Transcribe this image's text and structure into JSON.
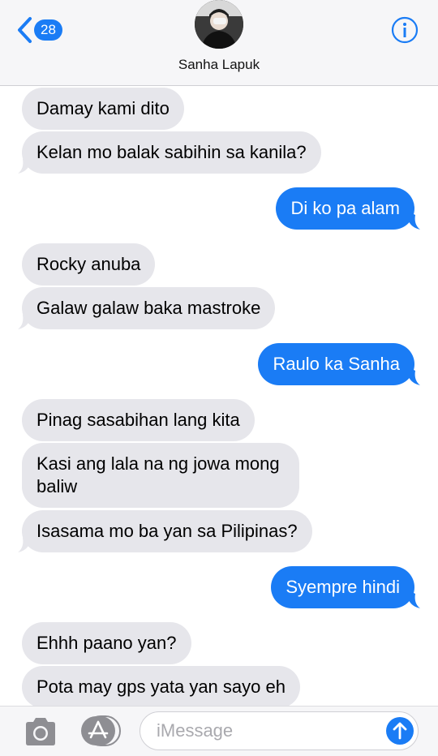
{
  "header": {
    "unread_count": "28",
    "contact_name": "Sanha Lapuk"
  },
  "messages": [
    {
      "dir": "in",
      "text": "Damay kami dito"
    },
    {
      "dir": "in",
      "text": "Kelan mo balak sabihin sa kanila?"
    },
    {
      "dir": "out",
      "text": "Di ko pa alam"
    },
    {
      "dir": "in",
      "text": "Rocky anuba"
    },
    {
      "dir": "in",
      "text": "Galaw galaw baka mastroke"
    },
    {
      "dir": "out",
      "text": "Raulo ka Sanha"
    },
    {
      "dir": "in",
      "text": "Pinag sasabihan lang kita"
    },
    {
      "dir": "in",
      "text": "Kasi ang lala na ng jowa mong baliw"
    },
    {
      "dir": "in",
      "text": "Isasama mo ba yan sa Pilipinas?"
    },
    {
      "dir": "out",
      "text": "Syempre hindi"
    },
    {
      "dir": "in",
      "text": "Ehhh paano yan?"
    },
    {
      "dir": "in",
      "text": "Pota may gps yata yan sayo eh"
    }
  ],
  "input": {
    "placeholder": "iMessage"
  },
  "colors": {
    "accent": "#1a7cf5",
    "incoming_bubble": "#e6e6eb",
    "outgoing_bubble": "#1a7cf5"
  },
  "icons": [
    "back-chevron-icon",
    "info-icon",
    "camera-icon",
    "appstore-icon",
    "send-arrow-icon"
  ]
}
